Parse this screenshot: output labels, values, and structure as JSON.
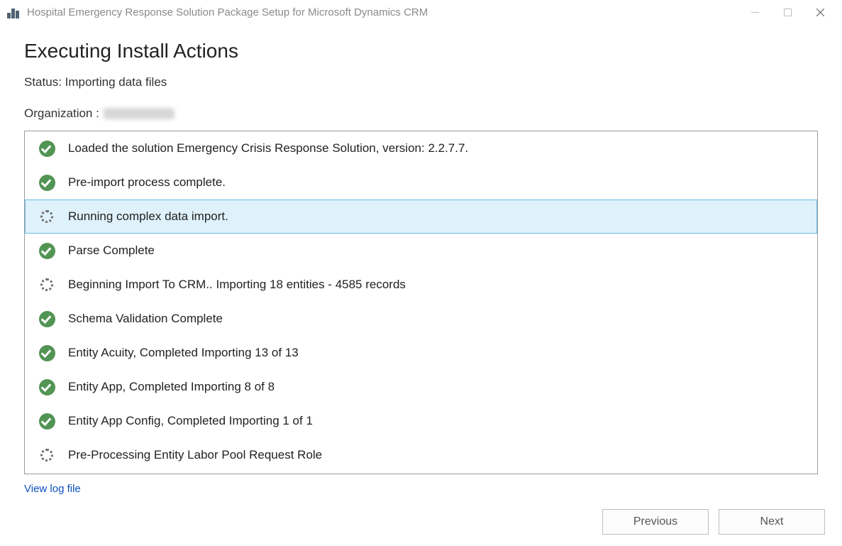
{
  "window": {
    "title": "Hospital Emergency Response Solution Package Setup for Microsoft Dynamics CRM"
  },
  "page": {
    "heading": "Executing Install Actions",
    "status_label": "Status:",
    "status_value": "Importing data files",
    "org_label": "Organization :"
  },
  "log": {
    "items": [
      {
        "status": "done",
        "text": "Loaded the solution Emergency Crisis Response Solution, version: 2.2.7.7."
      },
      {
        "status": "done",
        "text": "Pre-import process complete."
      },
      {
        "status": "running",
        "text": "Running complex data import.",
        "selected": true
      },
      {
        "status": "done",
        "text": "Parse Complete"
      },
      {
        "status": "running",
        "text": "Beginning Import To CRM.. Importing 18 entities - 4585 records"
      },
      {
        "status": "done",
        "text": "Schema Validation Complete"
      },
      {
        "status": "done",
        "text": "Entity Acuity, Completed Importing 13 of 13"
      },
      {
        "status": "done",
        "text": "Entity App, Completed Importing 8 of 8"
      },
      {
        "status": "done",
        "text": "Entity App Config, Completed Importing 1 of 1"
      },
      {
        "status": "running",
        "text": "Pre-Processing Entity Labor Pool Request Role"
      }
    ]
  },
  "links": {
    "view_log": "View log file"
  },
  "buttons": {
    "previous": "Previous",
    "next": "Next"
  }
}
